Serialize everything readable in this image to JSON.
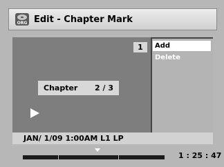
{
  "header": {
    "badge": "ORG",
    "title": "Edit - Chapter Mark"
  },
  "video": {
    "chapter_number": "1",
    "chapter_label": "Chapter",
    "chapter_value": "2 / 3"
  },
  "menu": {
    "items": [
      {
        "label": "Add",
        "selected": true
      },
      {
        "label": "Delete",
        "selected": false
      }
    ]
  },
  "status": {
    "text": "JAN/ 1/09 1:00AM L1   LP"
  },
  "timeline": {
    "time": "1 : 25 : 47"
  },
  "colors": {
    "panel": "#444444",
    "video": "#7e7e7e",
    "selected_bg": "#ffffff"
  }
}
